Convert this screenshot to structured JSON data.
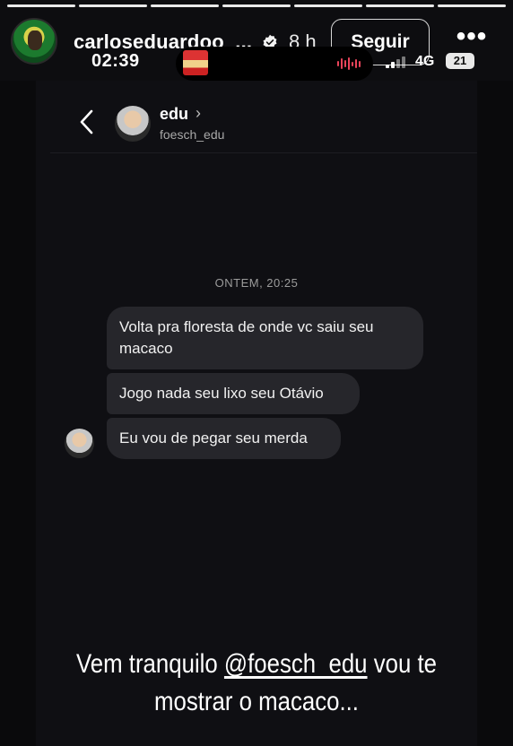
{
  "story": {
    "username": "carloseduardoo_...",
    "time_ago": "8 h",
    "follow_label": "Seguir",
    "more_icon": "more-horizontal-icon",
    "progress_segments": 7,
    "progress_done": 7
  },
  "status_bar": {
    "time": "02:39",
    "network": "4G",
    "battery": "21"
  },
  "dm_header": {
    "name": "edu",
    "handle": "foesch_edu",
    "chevron": "›"
  },
  "chat": {
    "timestamp": "ONTEM, 20:25",
    "messages": [
      "Volta pra floresta de onde vc saiu seu macaco",
      "Jogo nada seu lixo seu Otávio",
      "Eu vou de pegar seu merda"
    ]
  },
  "caption": {
    "prefix": "Vem tranquilo ",
    "mention": "@foesch_edu",
    "suffix": "  vou te mostrar o macaco..."
  },
  "colors": {
    "background": "#0d0d10",
    "bubble": "#26262b",
    "text": "#ffffff",
    "muted": "#9c9c9c"
  }
}
